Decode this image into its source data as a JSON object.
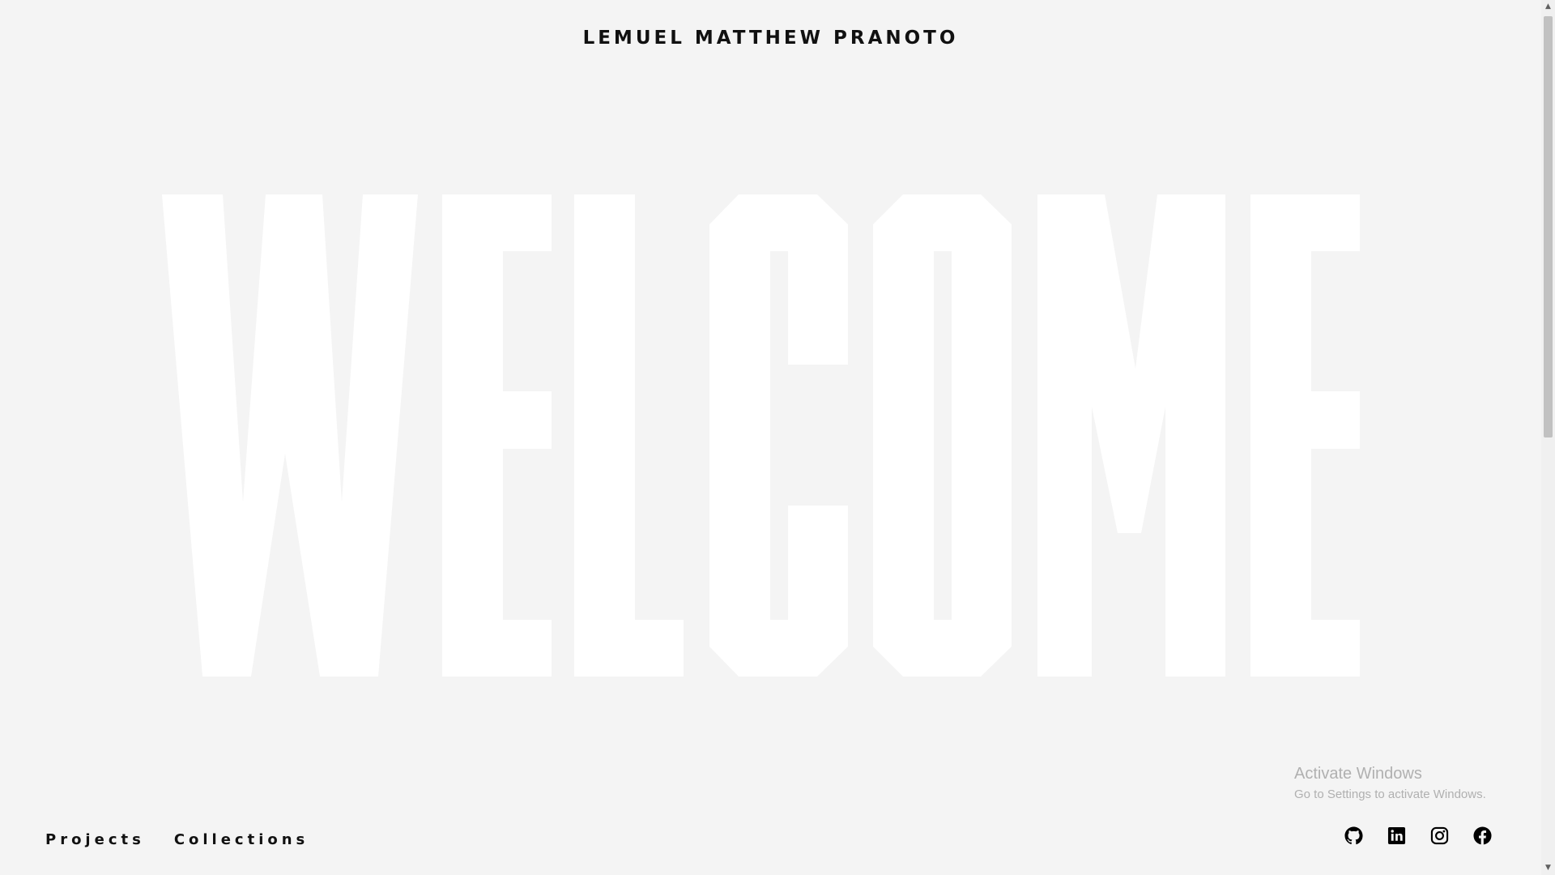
{
  "header": {
    "site_title": "LEMUEL MATTHEW PRANOTO"
  },
  "hero": {
    "word": "WELCOME"
  },
  "nav": {
    "items": [
      {
        "label": "Projects"
      },
      {
        "label": "Collections"
      }
    ]
  },
  "social": {
    "icons": [
      "github-icon",
      "linkedin-icon",
      "instagram-icon",
      "facebook-icon"
    ]
  },
  "os_overlay": {
    "activate_title": "Activate Windows",
    "activate_subtitle": "Go to Settings to activate Windows."
  },
  "colors": {
    "background": "#f4f4f4",
    "hero_letters": "#ffffff",
    "text": "#111111",
    "overlay_text": "#b0b0b0"
  }
}
